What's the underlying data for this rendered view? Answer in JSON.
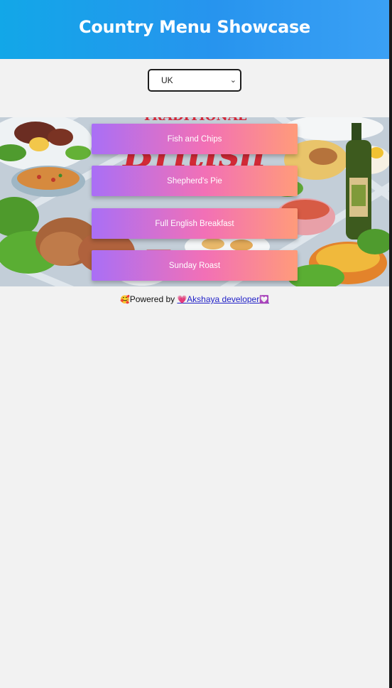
{
  "header": {
    "title": "Country Menu Showcase"
  },
  "country_select": {
    "selected": "UK",
    "chevron": "chevron-down-icon"
  },
  "banner": {
    "image": "traditional-british-food-illustration"
  },
  "menu": {
    "items": [
      {
        "label": "Fish and Chips"
      },
      {
        "label": "Shepherd's Pie"
      },
      {
        "label": "Full English Breakfast"
      },
      {
        "label": "Sunday Roast"
      }
    ]
  },
  "footer": {
    "prefix": "Powered by",
    "link_text": "Akshaya developer",
    "emoji_lead": "🥰",
    "emoji_heart": "💗",
    "emoji_end": "💟"
  },
  "colors": {
    "header_start": "#12a7e8",
    "header_end": "#3aa0f5",
    "button_start": "#a96ff6",
    "button_end": "#ff9b7a",
    "page_bg": "#f2f2f2"
  }
}
